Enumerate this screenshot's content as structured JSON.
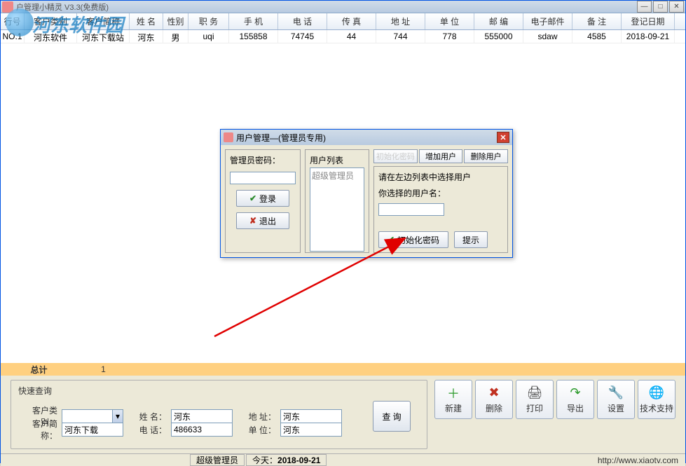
{
  "window": {
    "title": "户管理小精灵 V3.3(免费版)"
  },
  "winbtns": {
    "min": "—",
    "max": "□",
    "close": "✕"
  },
  "grid": {
    "headers": [
      "行号",
      "客户类别",
      "客户简称",
      "姓 名",
      "性别",
      "职 务",
      "手 机",
      "电 话",
      "传 真",
      "地 址",
      "单 位",
      "邮 编",
      "电子邮件",
      "备 注",
      "登记日期"
    ],
    "row": [
      "NO.1",
      "河东软件",
      "河东下载站",
      "河东",
      "男",
      "uqi",
      "155858",
      "74745",
      "44",
      "744",
      "778",
      "555000",
      "sdaw",
      "4585",
      "2018-09-21"
    ],
    "foot_label": "总计",
    "foot_count": "1"
  },
  "search": {
    "title": "快速查询",
    "labels": {
      "cat": "客户类别：",
      "name": "姓 名：",
      "addr": "地 址：",
      "short": "客户简称：",
      "tel": "电 话：",
      "unit": "单 位：",
      "btn": "查 询"
    },
    "values": {
      "name": "河东",
      "addr": "河东",
      "short": "河东下载",
      "tel": "486633",
      "unit": "河东"
    }
  },
  "toolbar": [
    {
      "label": "新建",
      "icon": "＋",
      "color": "#2a9a2a"
    },
    {
      "label": "删除",
      "icon": "✖",
      "color": "#c03020"
    },
    {
      "label": "打印",
      "icon": "🖨",
      "color": "#444"
    },
    {
      "label": "导出",
      "icon": "↷",
      "color": "#2a9a2a"
    },
    {
      "label": "设置",
      "icon": "🔧",
      "color": "#c08020"
    },
    {
      "label": "技术支持",
      "icon": "🌐",
      "color": "#2080c0"
    }
  ],
  "status": {
    "seg1": "超级管理员",
    "seg2_pre": "今天：",
    "seg2_date": "2018-09-21",
    "url": "http://www.xiaotv.com"
  },
  "dialog": {
    "title": "用户管理—(管理员专用)",
    "left": {
      "pwd": "管理员密码：",
      "login": "登录",
      "exit": "退出"
    },
    "mid": {
      "title": "用户列表",
      "item": "超级管理员"
    },
    "right": {
      "tabs": [
        "初始化密码",
        "增加用户",
        "删除用户"
      ],
      "hint": "请在左边列表中选择用户",
      "sel": "你选择的用户名：",
      "init": "初始化密码",
      "tip": "提示"
    }
  },
  "watermark": "河东软件园"
}
